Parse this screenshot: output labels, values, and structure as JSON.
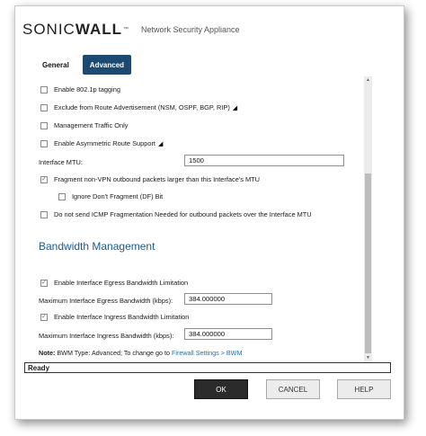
{
  "brand": {
    "logo_part1": "SONIC",
    "logo_part2": "WALL",
    "trademark": "™",
    "product": "Network Security Appliance"
  },
  "tabs": [
    {
      "label": "General",
      "active": false
    },
    {
      "label": "Advanced",
      "active": true
    }
  ],
  "options": {
    "enable_8021p": {
      "label": "Enable 802.1p tagging",
      "checked": false
    },
    "exclude_route_adv": {
      "label": "Exclude from Route Advertisement (NSM, OSPF, BGP, RIP)",
      "checked": false
    },
    "mgmt_traffic_only": {
      "label": "Management Traffic Only",
      "checked": false
    },
    "asym_route": {
      "label": "Enable Asymmetric Route Support",
      "checked": false
    },
    "mtu": {
      "label": "Interface MTU:",
      "value": "1500"
    },
    "fragment": {
      "label": "Fragment non-VPN outbound packets larger than this Interface's MTU",
      "checked": true
    },
    "ignore_df": {
      "label": "Ignore Don't Fragment (DF) Bit",
      "checked": false
    },
    "no_icmp_frag": {
      "label": "Do not send ICMP Fragmentation Needed for outbound packets over the Interface MTU",
      "checked": false
    }
  },
  "bandwidth": {
    "title": "Bandwidth Management",
    "egress_enable": {
      "label": "Enable Interface Egress Bandwidth Limitation",
      "checked": true
    },
    "egress_max": {
      "label": "Maximum Interface Egress Bandwidth (kbps):",
      "value": "384.000000"
    },
    "ingress_enable": {
      "label": "Enable Interface Ingress Bandwidth Limitation",
      "checked": true
    },
    "ingress_max": {
      "label": "Maximum Interface Ingress Bandwidth (kbps):",
      "value": "384.000000"
    },
    "note_bold": "Note:",
    "note_text": " BWM Type: Advanced; To change go to ",
    "note_link": "Firewall Settings > BWM"
  },
  "status": "Ready",
  "buttons": {
    "ok": "OK",
    "cancel": "CANCEL",
    "help": "HELP"
  },
  "colors": {
    "accent": "#1d4a70",
    "section_title": "#1f5a89",
    "link": "#1f6fb5"
  }
}
